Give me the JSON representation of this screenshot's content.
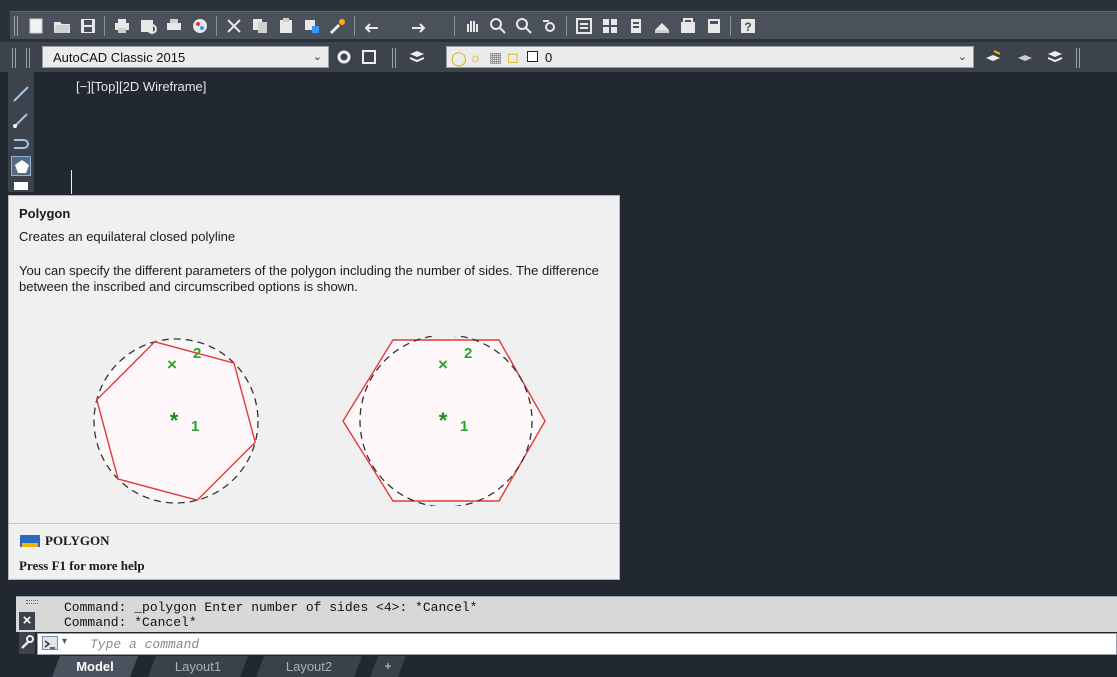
{
  "toolbar": {
    "icons": [
      "new-icon",
      "open-icon",
      "save-icon",
      "plot-icon",
      "plot-preview-icon",
      "publish-icon",
      "render-icon",
      "cut-icon",
      "copy-icon",
      "paste-icon",
      "match-properties-icon",
      "brush-icon",
      "undo-icon",
      "redo-icon",
      "pan-icon",
      "zoom-realtime-icon",
      "zoom-window-icon",
      "zoom-previous-icon",
      "properties-icon",
      "design-center-icon",
      "tool-palettes-icon",
      "sheet-set-icon",
      "markup-icon",
      "calculator-icon",
      "help-icon"
    ]
  },
  "workspace": {
    "value": "AutoCAD Classic 2015",
    "layer_value": "0"
  },
  "viewport": {
    "label": "[−][Top][2D Wireframe]"
  },
  "tooltip": {
    "title": "Polygon",
    "description": "Creates an equilateral closed polyline",
    "body": "You can specify the different parameters of the polygon including the number of sides. The difference between the inscribed and circumscribed options is shown.",
    "figure": {
      "inscribed_label_center": "1",
      "inscribed_label_vertex": "2",
      "circumscribed_label_center": "1",
      "circumscribed_label_vertex": "2"
    },
    "command": "POLYGON",
    "help": "Press F1 for more help"
  },
  "command_line": {
    "history": [
      "Command:  _polygon Enter number of sides <4>: *Cancel*",
      "Command: *Cancel*"
    ],
    "placeholder": "Type a command"
  },
  "tabs": [
    "Model",
    "Layout1",
    "Layout2"
  ],
  "tab_add": "+",
  "colors": {
    "background": "#212830",
    "tooltip_bg": "#f0f0f0",
    "polygon_red": "#e23a3a",
    "marker_green": "#2aa52a"
  }
}
